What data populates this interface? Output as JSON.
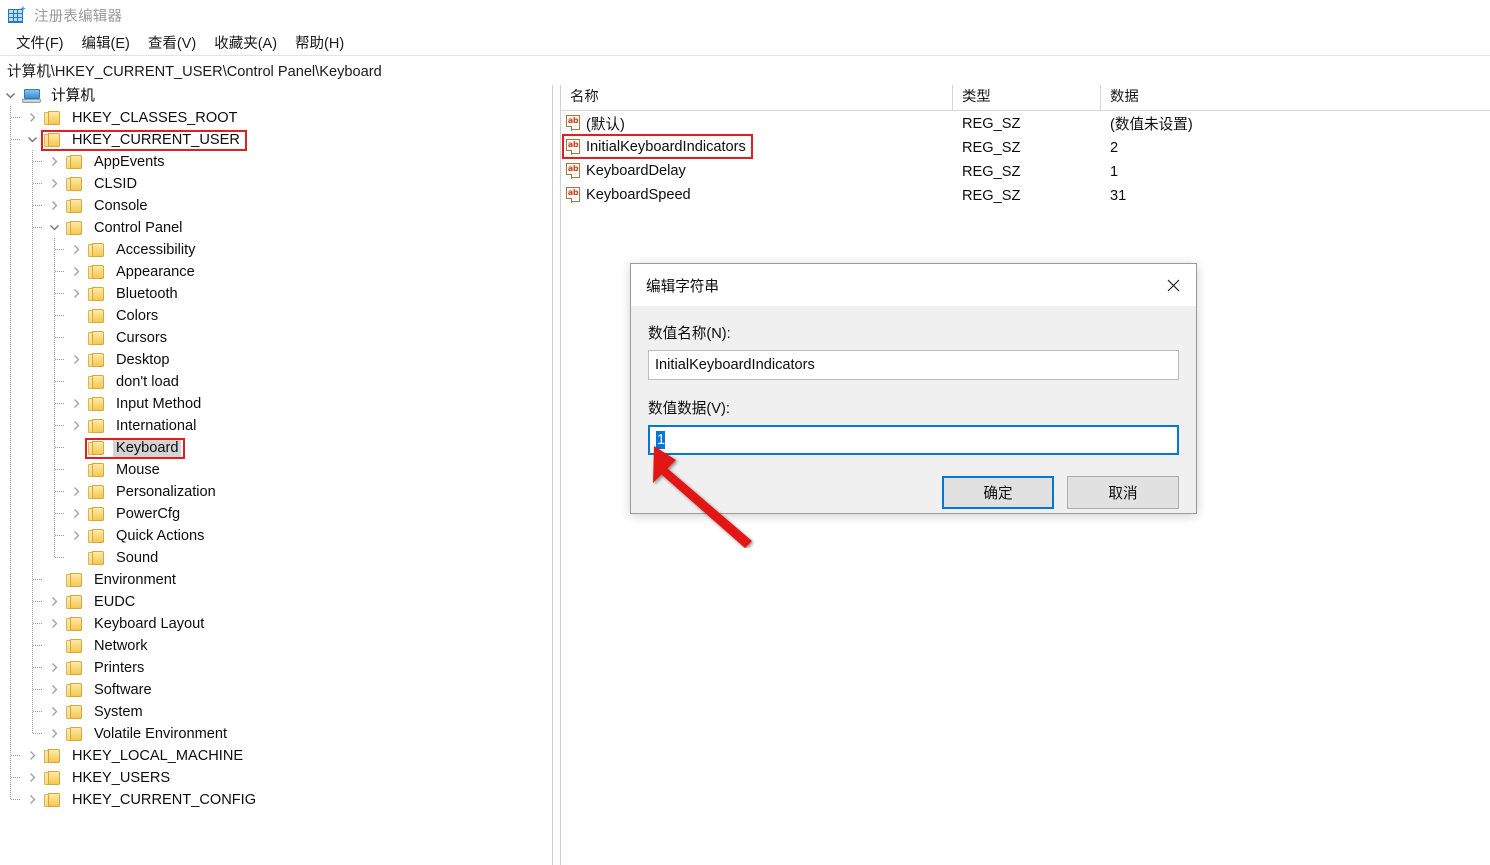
{
  "window": {
    "title": "注册表编辑器",
    "app_icon": "registry-editor-icon"
  },
  "menubar": {
    "items": [
      {
        "label": "文件(F)",
        "name": "menu-file"
      },
      {
        "label": "编辑(E)",
        "name": "menu-edit"
      },
      {
        "label": "查看(V)",
        "name": "menu-view"
      },
      {
        "label": "收藏夹(A)",
        "name": "menu-favorites"
      },
      {
        "label": "帮助(H)",
        "name": "menu-help"
      }
    ]
  },
  "address_bar": {
    "path": "计算机\\HKEY_CURRENT_USER\\Control Panel\\Keyboard"
  },
  "tree": {
    "nodes": [
      {
        "label": "计算机",
        "depth": 0,
        "icon": "computer-icon",
        "expander": "expanded",
        "selected": false,
        "highlight": false
      },
      {
        "label": "HKEY_CLASSES_ROOT",
        "depth": 1,
        "icon": "folder-icon",
        "expander": "collapsed",
        "selected": false,
        "highlight": false
      },
      {
        "label": "HKEY_CURRENT_USER",
        "depth": 1,
        "icon": "folder-icon",
        "expander": "expanded",
        "selected": false,
        "highlight": true
      },
      {
        "label": "AppEvents",
        "depth": 2,
        "icon": "folder-icon",
        "expander": "collapsed",
        "selected": false,
        "highlight": false
      },
      {
        "label": "CLSID",
        "depth": 2,
        "icon": "folder-icon",
        "expander": "collapsed",
        "selected": false,
        "highlight": false
      },
      {
        "label": "Console",
        "depth": 2,
        "icon": "folder-icon",
        "expander": "collapsed",
        "selected": false,
        "highlight": false
      },
      {
        "label": "Control Panel",
        "depth": 2,
        "icon": "folder-icon",
        "expander": "expanded",
        "selected": false,
        "highlight": false
      },
      {
        "label": "Accessibility",
        "depth": 3,
        "icon": "folder-icon",
        "expander": "collapsed",
        "selected": false,
        "highlight": false
      },
      {
        "label": "Appearance",
        "depth": 3,
        "icon": "folder-icon",
        "expander": "collapsed",
        "selected": false,
        "highlight": false
      },
      {
        "label": "Bluetooth",
        "depth": 3,
        "icon": "folder-icon",
        "expander": "collapsed",
        "selected": false,
        "highlight": false
      },
      {
        "label": "Colors",
        "depth": 3,
        "icon": "folder-icon",
        "expander": "leaf",
        "selected": false,
        "highlight": false
      },
      {
        "label": "Cursors",
        "depth": 3,
        "icon": "folder-icon",
        "expander": "leaf",
        "selected": false,
        "highlight": false
      },
      {
        "label": "Desktop",
        "depth": 3,
        "icon": "folder-icon",
        "expander": "collapsed",
        "selected": false,
        "highlight": false
      },
      {
        "label": "don't load",
        "depth": 3,
        "icon": "folder-icon",
        "expander": "leaf",
        "selected": false,
        "highlight": false
      },
      {
        "label": "Input Method",
        "depth": 3,
        "icon": "folder-icon",
        "expander": "collapsed",
        "selected": false,
        "highlight": false
      },
      {
        "label": "International",
        "depth": 3,
        "icon": "folder-icon",
        "expander": "collapsed",
        "selected": false,
        "highlight": false
      },
      {
        "label": "Keyboard",
        "depth": 3,
        "icon": "folder-icon",
        "expander": "leaf",
        "selected": true,
        "highlight": true
      },
      {
        "label": "Mouse",
        "depth": 3,
        "icon": "folder-icon",
        "expander": "leaf",
        "selected": false,
        "highlight": false
      },
      {
        "label": "Personalization",
        "depth": 3,
        "icon": "folder-icon",
        "expander": "collapsed",
        "selected": false,
        "highlight": false
      },
      {
        "label": "PowerCfg",
        "depth": 3,
        "icon": "folder-icon",
        "expander": "collapsed",
        "selected": false,
        "highlight": false
      },
      {
        "label": "Quick Actions",
        "depth": 3,
        "icon": "folder-icon",
        "expander": "collapsed",
        "selected": false,
        "highlight": false
      },
      {
        "label": "Sound",
        "depth": 3,
        "icon": "folder-icon",
        "expander": "leaf",
        "selected": false,
        "highlight": false
      },
      {
        "label": "Environment",
        "depth": 2,
        "icon": "folder-icon",
        "expander": "leaf",
        "selected": false,
        "highlight": false
      },
      {
        "label": "EUDC",
        "depth": 2,
        "icon": "folder-icon",
        "expander": "collapsed",
        "selected": false,
        "highlight": false
      },
      {
        "label": "Keyboard Layout",
        "depth": 2,
        "icon": "folder-icon",
        "expander": "collapsed",
        "selected": false,
        "highlight": false
      },
      {
        "label": "Network",
        "depth": 2,
        "icon": "folder-icon",
        "expander": "leaf",
        "selected": false,
        "highlight": false
      },
      {
        "label": "Printers",
        "depth": 2,
        "icon": "folder-icon",
        "expander": "collapsed",
        "selected": false,
        "highlight": false
      },
      {
        "label": "Software",
        "depth": 2,
        "icon": "folder-icon",
        "expander": "collapsed",
        "selected": false,
        "highlight": false
      },
      {
        "label": "System",
        "depth": 2,
        "icon": "folder-icon",
        "expander": "collapsed",
        "selected": false,
        "highlight": false
      },
      {
        "label": "Volatile Environment",
        "depth": 2,
        "icon": "folder-icon",
        "expander": "collapsed",
        "selected": false,
        "highlight": false
      },
      {
        "label": "HKEY_LOCAL_MACHINE",
        "depth": 1,
        "icon": "folder-icon",
        "expander": "collapsed",
        "selected": false,
        "highlight": false
      },
      {
        "label": "HKEY_USERS",
        "depth": 1,
        "icon": "folder-icon",
        "expander": "collapsed",
        "selected": false,
        "highlight": false
      },
      {
        "label": "HKEY_CURRENT_CONFIG",
        "depth": 1,
        "icon": "folder-icon",
        "expander": "collapsed",
        "selected": false,
        "highlight": false
      }
    ]
  },
  "list": {
    "columns": [
      {
        "label": "名称",
        "name": "column-name"
      },
      {
        "label": "类型",
        "name": "column-type"
      },
      {
        "label": "数据",
        "name": "column-data"
      }
    ],
    "rows": [
      {
        "name": "(默认)",
        "type": "REG_SZ",
        "data": "(数值未设置)",
        "icon": "string-value-icon",
        "highlight": false
      },
      {
        "name": "InitialKeyboardIndicators",
        "type": "REG_SZ",
        "data": "2",
        "icon": "string-value-icon",
        "highlight": true
      },
      {
        "name": "KeyboardDelay",
        "type": "REG_SZ",
        "data": "1",
        "icon": "string-value-icon",
        "highlight": false
      },
      {
        "name": "KeyboardSpeed",
        "type": "REG_SZ",
        "data": "31",
        "icon": "string-value-icon",
        "highlight": false
      }
    ]
  },
  "dialog": {
    "title": "编辑字符串",
    "close_icon": "close-icon",
    "name_label": "数值名称(N):",
    "name_value": "InitialKeyboardIndicators",
    "data_label": "数值数据(V):",
    "data_value": "1",
    "ok_label": "确定",
    "cancel_label": "取消"
  },
  "annotation": {
    "arrow_color": "#e31414",
    "highlight_color": "#e02020"
  }
}
